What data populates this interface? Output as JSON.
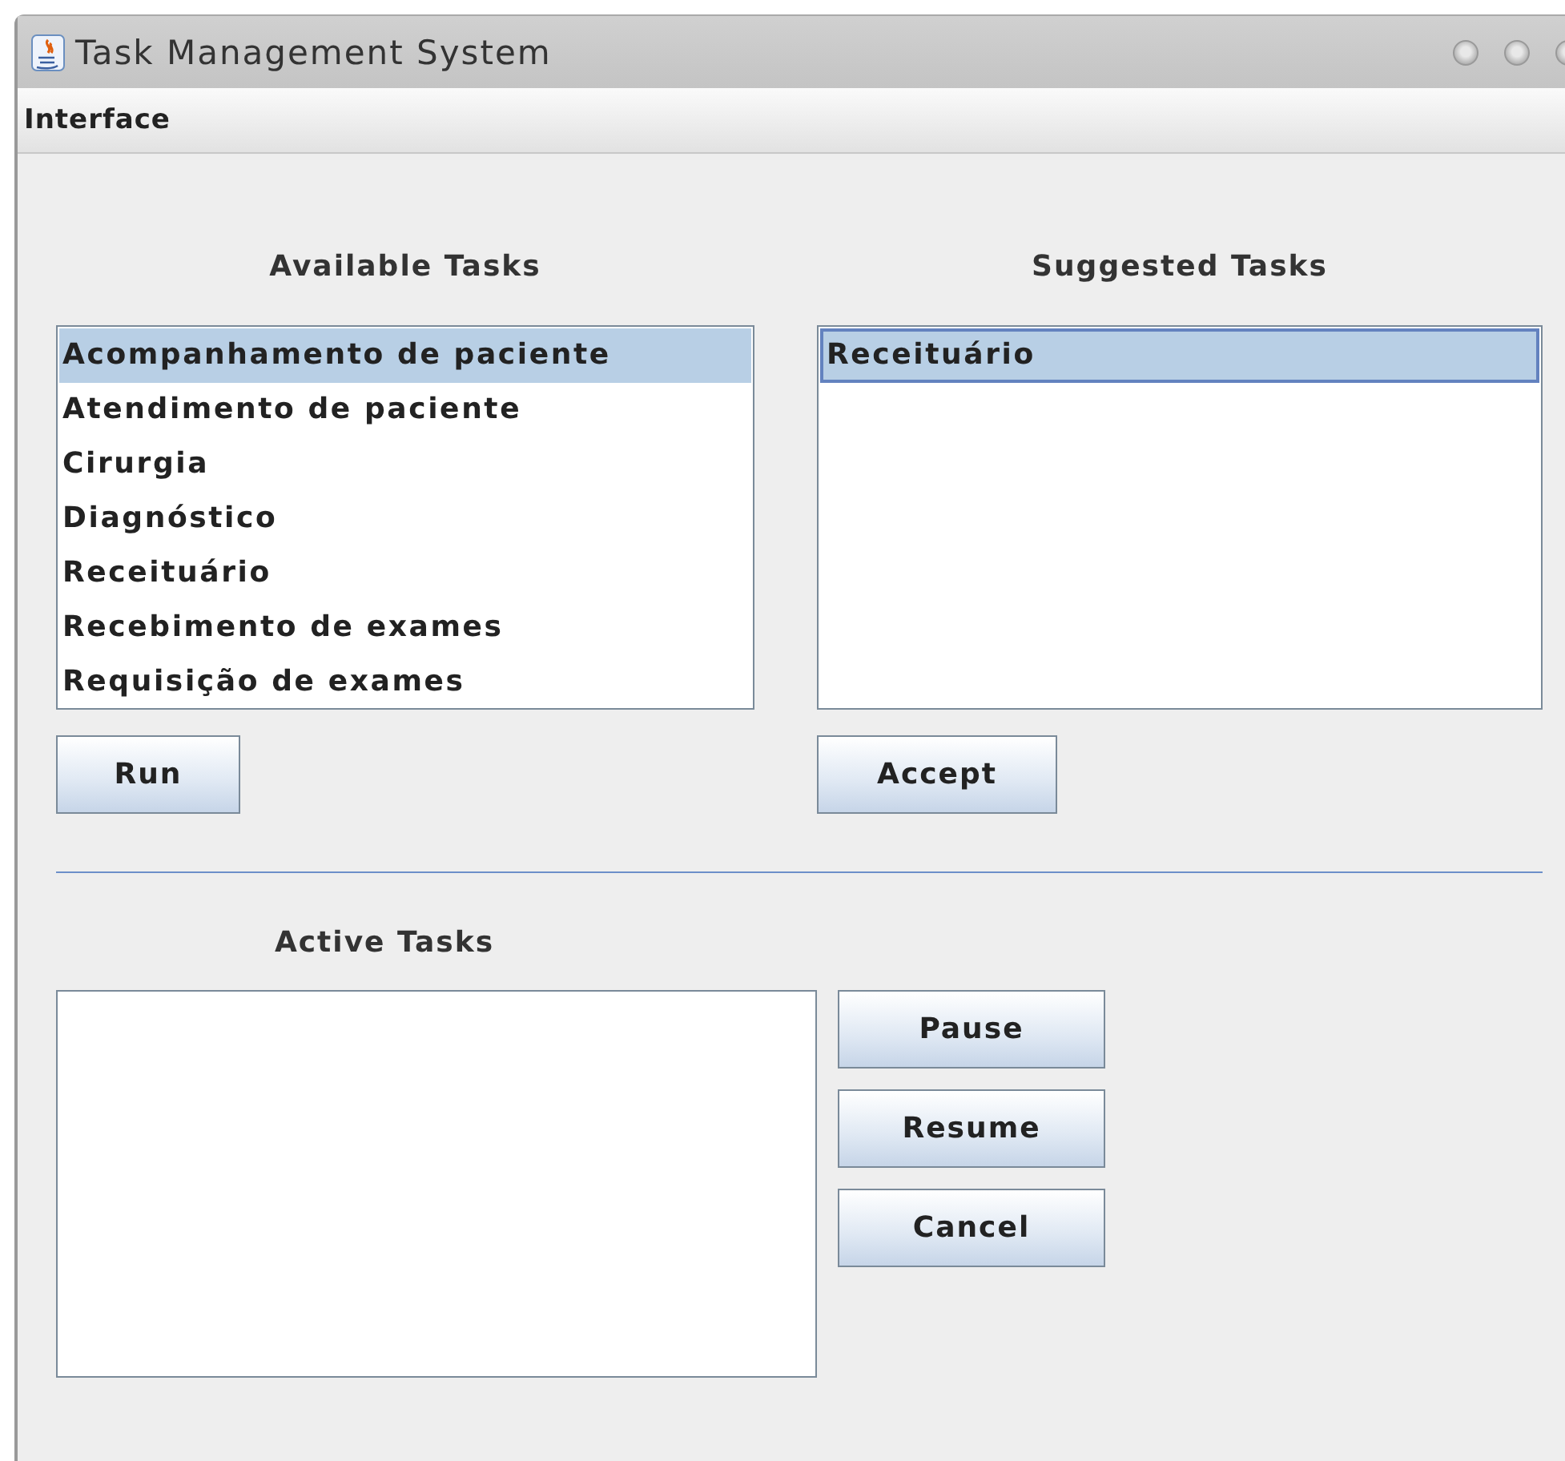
{
  "window": {
    "title": "Task Management System"
  },
  "menu": [
    {
      "label": "Interface"
    }
  ],
  "available_tasks": {
    "label": "Available Tasks",
    "items": [
      {
        "text": "Acompanhamento de paciente",
        "selected": true
      },
      {
        "text": "Atendimento de paciente",
        "selected": false
      },
      {
        "text": "Cirurgia",
        "selected": false
      },
      {
        "text": "Diagnóstico",
        "selected": false
      },
      {
        "text": "Receituário",
        "selected": false
      },
      {
        "text": "Recebimento de exames",
        "selected": false
      },
      {
        "text": "Requisição de exames",
        "selected": false
      }
    ],
    "button": "Run"
  },
  "suggested_tasks": {
    "label": "Suggested Tasks",
    "items": [
      {
        "text": "Receituário",
        "selected": true
      }
    ],
    "button": "Accept"
  },
  "active_tasks": {
    "label": "Active Tasks",
    "buttons": [
      "Pause",
      "Resume",
      "Cancel"
    ]
  }
}
